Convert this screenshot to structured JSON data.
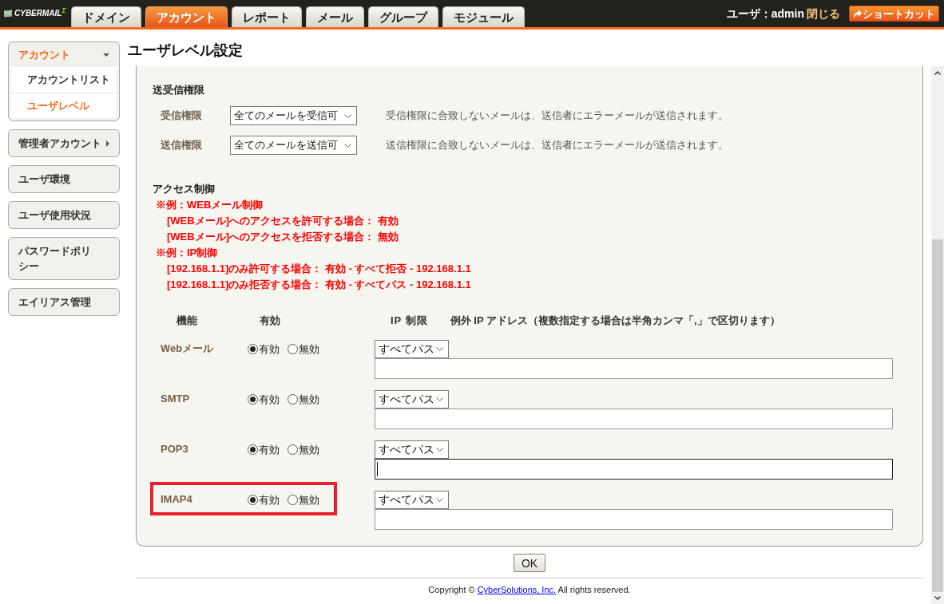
{
  "header": {
    "logo": "CYBERMAIL$^{Σ}$",
    "tabs": [
      {
        "label": "ドメイン",
        "selected": false
      },
      {
        "label": "アカウント",
        "selected": true
      },
      {
        "label": "レポート",
        "selected": false
      },
      {
        "label": "メール",
        "selected": false
      },
      {
        "label": "グループ",
        "selected": false
      },
      {
        "label": "モジュール",
        "selected": false
      }
    ],
    "user": "ユーザ：admin",
    "logout_link": "閉じる",
    "shortcut_button": "ショートカット"
  },
  "sidebar": {
    "items": [
      {
        "label": "アカウント",
        "kind": "group",
        "selected": true,
        "expanded": true,
        "children": [
          {
            "label": "アカウントリスト",
            "selected": false
          },
          {
            "label": "ユーザレベル",
            "selected": true
          }
        ]
      },
      {
        "label": "管理者アカウント",
        "kind": "group",
        "selected": false,
        "expanded": false
      },
      {
        "label": "ユーザ環境",
        "kind": "link",
        "selected": false
      },
      {
        "label": "ユーザ使用状況",
        "kind": "link",
        "selected": false
      },
      {
        "label": "パスワードポリシー",
        "kind": "link",
        "selected": false
      },
      {
        "label": "エイリアス管理",
        "kind": "link",
        "selected": false
      }
    ]
  },
  "page": {
    "title": "ユーザレベル設定",
    "permissions": {
      "heading": "送受信権限",
      "rows": [
        {
          "label": "受信権限",
          "value": "全てのメールを受信可",
          "note": "受信権限に合致しないメールは、送信者にエラーメールが送信されます。"
        },
        {
          "label": "送信権限",
          "value": "全てのメールを送信可",
          "note": "送信権限に合致しないメールは、送信者にエラーメールが送信されます。"
        }
      ]
    },
    "access_control": {
      "heading": "アクセス制御",
      "examples": [
        {
          "kind": "heading",
          "text": "※例：WEBメール制御"
        },
        {
          "kind": "line",
          "text": "[WEBメール]へのアクセスを許可する場合： 有効"
        },
        {
          "kind": "line",
          "text": "[WEBメール]へのアクセスを拒否する場合： 無効"
        },
        {
          "kind": "heading",
          "text": "※例：IP制御"
        },
        {
          "kind": "line",
          "text": "[192.168.1.1]のみ許可する場合： 有効 - すべて拒否 - 192.168.1.1"
        },
        {
          "kind": "line",
          "text": "[192.168.1.1]のみ拒否する場合： 有効 - すべてパス - 192.168.1.1"
        }
      ],
      "table": {
        "columns": [
          "機能",
          "有効",
          "IP 制限",
          "例外 IP アドレス（複数指定する場合は半角カンマ「,」で区切ります）"
        ],
        "rows": [
          {
            "name": "Webメール",
            "options": [
              {
                "label": "有効",
                "selected": true
              },
              {
                "label": "無効",
                "selected": false
              }
            ],
            "ip_limit": "すべてパス",
            "exception_field": {
              "focused": false
            },
            "highlighted": false
          },
          {
            "name": "SMTP",
            "options": [
              {
                "label": "有効",
                "selected": true
              },
              {
                "label": "無効",
                "selected": false
              }
            ],
            "ip_limit": "すべてパス",
            "exception_field": {
              "focused": false
            },
            "highlighted": false
          },
          {
            "name": "POP3",
            "options": [
              {
                "label": "有効",
                "selected": true
              },
              {
                "label": "無効",
                "selected": false
              }
            ],
            "ip_limit": "すべてパス",
            "exception_field": {
              "focused": true
            },
            "highlighted": false
          },
          {
            "name": "IMAP4",
            "options": [
              {
                "label": "有効",
                "selected": true
              },
              {
                "label": "無効",
                "selected": false
              }
            ],
            "ip_limit": "すべてパス",
            "exception_field": {
              "focused": false
            },
            "highlighted": true
          }
        ]
      }
    },
    "ok_button": "OK",
    "copyright": {
      "prefix": "Copyright © ",
      "link": "CyberSolutions, Inc.",
      "suffix": " All rights reserved."
    }
  }
}
